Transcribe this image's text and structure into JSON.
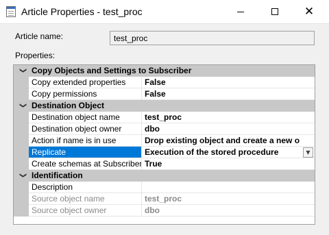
{
  "window": {
    "title": "Article Properties - test_proc",
    "minimize_icon": "minimize-icon",
    "maximize_icon": "maximize-icon",
    "close_icon": "close-icon"
  },
  "form": {
    "article_name_label": "Article name:",
    "article_name_value": "test_proc",
    "properties_label": "Properties:"
  },
  "grid": {
    "categories": [
      {
        "label": "Copy Objects and Settings to Subscriber",
        "properties": [
          {
            "name": "Copy extended properties",
            "value": "False"
          },
          {
            "name": "Copy permissions",
            "value": "False"
          }
        ]
      },
      {
        "label": "Destination Object",
        "properties": [
          {
            "name": "Destination object name",
            "value": "test_proc"
          },
          {
            "name": "Destination object owner",
            "value": "dbo"
          },
          {
            "name": "Action if name is in use",
            "value": "Drop existing object and create a new o"
          },
          {
            "name": "Replicate",
            "value": "Execution of the stored procedure",
            "selected": true,
            "dropdown": true
          },
          {
            "name": "Create schemas at Subscriber",
            "value": "True"
          }
        ]
      },
      {
        "label": "Identification",
        "properties": [
          {
            "name": "Description",
            "value": ""
          },
          {
            "name": "Source object name",
            "value": "test_proc",
            "disabled": true
          },
          {
            "name": "Source object owner",
            "value": "dbo",
            "disabled": true
          }
        ]
      }
    ]
  },
  "colors": {
    "selection": "#0078d7",
    "category_band": "#c8c8c8",
    "dialog_background": "#f0f0f0"
  }
}
